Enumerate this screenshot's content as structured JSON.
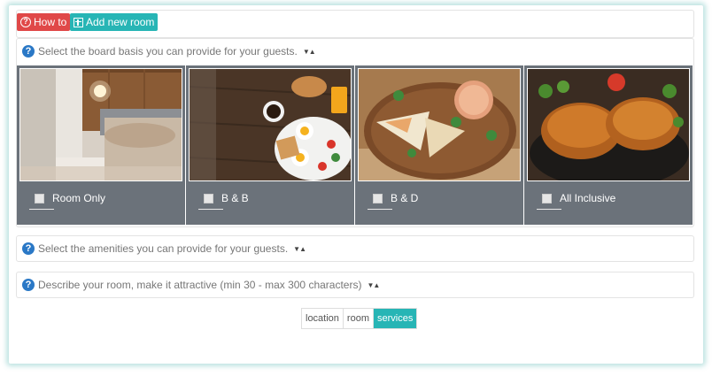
{
  "toolbar": {
    "howto_label": "How to",
    "add_room_label": "Add new room"
  },
  "sections": {
    "board_basis": "Select the board basis you can provide for your guests.",
    "amenities": "Select the amenities you can provide for your guests.",
    "description": "Describe your room, make it attractive (min 30 - max 300 characters)"
  },
  "board_options": [
    {
      "label": "Room Only",
      "image": "bedroom-photo"
    },
    {
      "label": "B & B",
      "image": "breakfast-photo"
    },
    {
      "label": "B & D",
      "image": "quesadilla-dinner-photo"
    },
    {
      "label": "All Inclusive",
      "image": "roast-chicken-photo"
    }
  ],
  "tabs": [
    {
      "label": "location",
      "active": false
    },
    {
      "label": "room",
      "active": false
    },
    {
      "label": "services",
      "active": true
    }
  ],
  "colors": {
    "howto": "#e04848",
    "accent": "#27b5b5",
    "card_bg": "#6b727a",
    "help_icon": "#2a78c6"
  }
}
